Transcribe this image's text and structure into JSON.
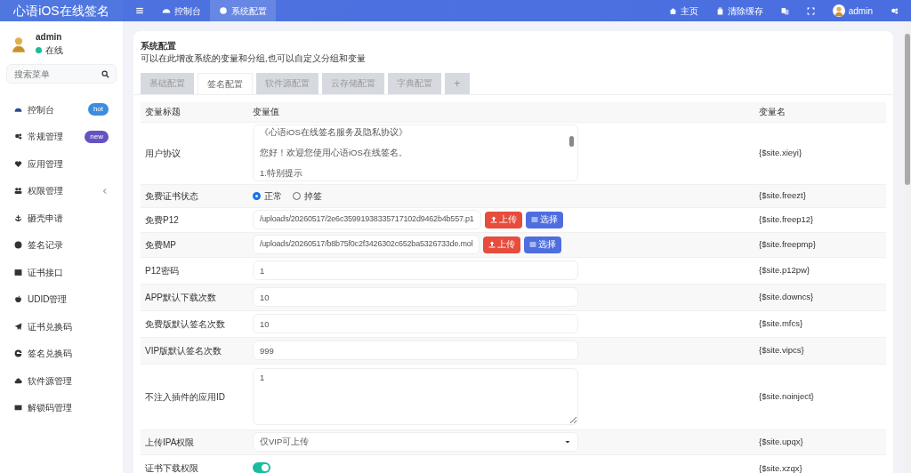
{
  "brand": "心语iOS在线签名",
  "top_nav": [
    {
      "label": "控制台",
      "selected": false
    },
    {
      "label": "系统配置",
      "selected": true
    }
  ],
  "top_right": [
    {
      "label": "主页"
    },
    {
      "label": "清除缓存"
    },
    {
      "label": "admin"
    }
  ],
  "user": {
    "name": "admin",
    "status": "在线"
  },
  "search": {
    "placeholder": "搜索菜单"
  },
  "sidebar": {
    "items": [
      {
        "label": "控制台",
        "badge": "hot",
        "color": "#3c8dde",
        "selected": false
      },
      {
        "label": "常规管理",
        "badge": "new",
        "color": "#6554c0",
        "selected": false
      },
      {
        "label": "应用管理",
        "selected": false
      },
      {
        "label": "权限管理",
        "expandable": true,
        "selected": false
      },
      {
        "label": "砸壳申请",
        "selected": false
      },
      {
        "label": "签名记录",
        "selected": false
      },
      {
        "label": "证书接口",
        "selected": false
      },
      {
        "label": "UDID管理",
        "selected": false
      },
      {
        "label": "证书兑换码",
        "selected": false
      },
      {
        "label": "签名兑换码",
        "selected": false
      },
      {
        "label": "软件源管理",
        "selected": false
      },
      {
        "label": "解锁码管理",
        "selected": false
      }
    ]
  },
  "panel": {
    "title": "系统配置",
    "description": "可以在此增改系统的变量和分组,也可以自定义分组和变量"
  },
  "tabs": [
    {
      "label": "基础配置",
      "selected": false
    },
    {
      "label": "签名配置",
      "selected": true
    },
    {
      "label": "软件源配置",
      "selected": false
    },
    {
      "label": "云存储配置",
      "selected": false
    },
    {
      "label": "字典配置",
      "selected": false
    },
    {
      "label": "+",
      "selected": false
    }
  ],
  "table": {
    "columns": [
      "变量标题",
      "变量值",
      "变量名"
    ],
    "rows": [
      {
        "kind": "textarea",
        "title": "用户协议",
        "lines": [
          "《心语iOS在线签名服务及隐私协议》",
          "您好！欢迎您使用心语iOS在线签名。",
          "1.特别提示"
        ],
        "name": "{$site.xieyi}"
      },
      {
        "kind": "radio",
        "title": "免费证书状态",
        "options": [
          {
            "label": "正常",
            "selected": true
          },
          {
            "label": "掉签",
            "selected": false
          }
        ],
        "name": "{$site.freezt}"
      },
      {
        "kind": "file",
        "title": "免费P12",
        "value": "/uploads/20260517/2e6c35991938335717102d9462b4b557.p1",
        "buttons": [
          {
            "kind": "upload",
            "label": "上传"
          },
          {
            "kind": "choose",
            "label": "选择"
          }
        ],
        "name": "{$site.freep12}"
      },
      {
        "kind": "file",
        "title": "免费MP",
        "value": "/uploads/20260517/b8b75f0c2f3426302c652ba5326733de.mol",
        "buttons": [
          {
            "kind": "upload",
            "label": "上传"
          },
          {
            "kind": "choose",
            "label": "选择"
          }
        ],
        "name": "{$site.freepmp}"
      },
      {
        "kind": "text",
        "title": "P12密码",
        "value": "1",
        "name": "{$site.p12pw}"
      },
      {
        "kind": "text",
        "title": "APP默认下载次数",
        "value": "10",
        "name": "{$site.downcs}"
      },
      {
        "kind": "text",
        "title": "免费版默认签名次数",
        "value": "10",
        "name": "{$site.mfcs}"
      },
      {
        "kind": "text",
        "title": "VIP版默认签名次数",
        "value": "999",
        "name": "{$site.vipcs}"
      },
      {
        "kind": "bigtext",
        "title": "不注入插件的应用ID",
        "value": "1",
        "name": "{$site.noinject}"
      },
      {
        "kind": "select",
        "title": "上传IPA权限",
        "value": "仅VIP可上传",
        "name": "{$site.upqx}"
      },
      {
        "kind": "switch",
        "title": "证书下载权限",
        "on": true,
        "name": "{$site.xzqx}"
      }
    ]
  }
}
